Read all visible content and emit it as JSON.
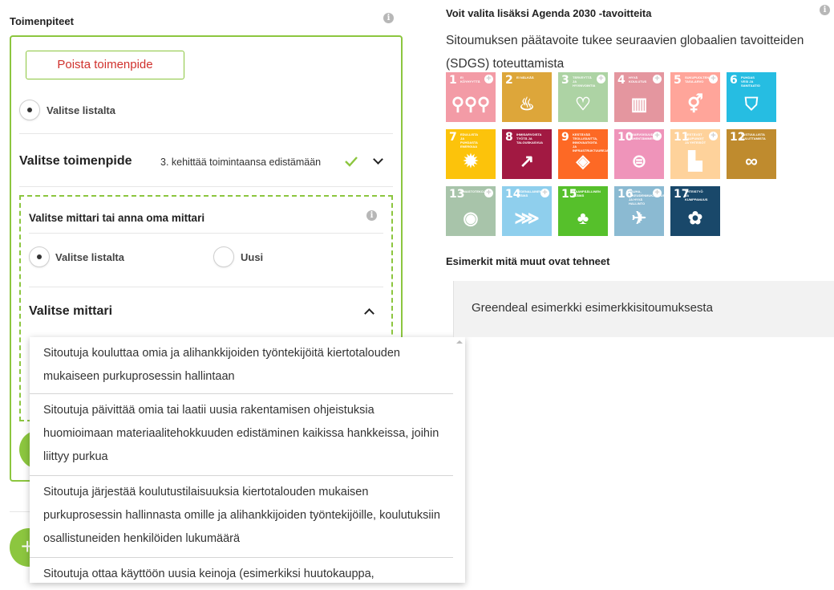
{
  "left": {
    "section_title": "Toimenpiteet",
    "remove_button": "Poista toimenpide",
    "choose_from_list": "Valitse listalta",
    "select_action_label": "Valitse toimenpide",
    "selected_action_value": "3. kehittää toimintaansa edistämään",
    "metric_box": {
      "title": "Valitse mittari tai anna oma mittari",
      "option_list": "Valitse listalta",
      "option_new": "Uusi",
      "select_metric_label": "Valitse mittari"
    }
  },
  "dropdown": {
    "items": [
      "Sitoutuja kouluttaa omia ja alihankkijoiden työntekijöitä kiertotalouden mukaiseen purkuprosessin hallintaan",
      "Sitoutuja päivittää omia tai laatii uusia rakentamisen ohjeistuksia huomioimaan materiaalitehokkuuden edistäminen kaikissa hankkeissa, joihin liittyy purkua",
      "Sitoutuja järjestää koulutustilaisuuksia kiertotalouden mukaisen purkuprosessin hallinnasta omille ja alihankkijoiden työntekijöille, koulutuksiin osallistuneiden henkilöiden lukumäärä",
      "Sitoutuja ottaa käyttöön uusia keinoja (esimerkiksi huutokauppa,"
    ]
  },
  "right": {
    "agenda_title": "Voit valita lisäksi Agenda 2030 -tavoitteita",
    "agenda_desc": "Sitoumuksen päätavoite tukee seuraavien globaalien tavoitteiden (SDGS) toteuttamista",
    "examples_title": "Esimerkit mitä muut ovat tehneet",
    "example_item": "Greendeal esimerkki esimerkkisitoumuksesta"
  },
  "sdg_goals": [
    {
      "num": "1",
      "label": "Ei köyhyyttä",
      "color": "#e5243b",
      "icon": "family-icon",
      "glyph": "⚲⚲⚲",
      "selected": false
    },
    {
      "num": "2",
      "label": "Ei nälkää",
      "color": "#dda63a",
      "icon": "bowl-icon",
      "glyph": "♨",
      "selected": true
    },
    {
      "num": "3",
      "label": "Terveyttä ja hyvinvointia",
      "color": "#4c9f38",
      "icon": "heartbeat-icon",
      "glyph": "♡",
      "selected": false
    },
    {
      "num": "4",
      "label": "Hyvä koulutus",
      "color": "#c5192d",
      "icon": "book-icon",
      "glyph": "▥",
      "selected": false
    },
    {
      "num": "5",
      "label": "Sukupuolten tasa-arvo",
      "color": "#ff3a21",
      "icon": "gender-icon",
      "glyph": "⚥",
      "selected": false
    },
    {
      "num": "6",
      "label": "Puhdas vesi ja sanitaatio",
      "color": "#26bde2",
      "icon": "water-icon",
      "glyph": "⛉",
      "selected": true
    },
    {
      "num": "7",
      "label": "Edullista ja puhdasta energiaa",
      "color": "#fcc30b",
      "icon": "sun-icon",
      "glyph": "✹",
      "selected": true
    },
    {
      "num": "8",
      "label": "Ihmisarvoista työtä ja talouskasvua",
      "color": "#a21942",
      "icon": "growth-icon",
      "glyph": "↗",
      "selected": true
    },
    {
      "num": "9",
      "label": "Kestävää teollisuutta, innovaatioita ja infrastruktuureja",
      "color": "#fd6925",
      "icon": "blocks-icon",
      "glyph": "◈",
      "selected": true
    },
    {
      "num": "10",
      "label": "Eriarvoisuuden vähentäminen",
      "color": "#dd1367",
      "icon": "equal-icon",
      "glyph": "⊜",
      "selected": false
    },
    {
      "num": "11",
      "label": "Kestävät kaupungit ja yhteisöt",
      "color": "#fd9d24",
      "icon": "city-icon",
      "glyph": "▙",
      "selected": false
    },
    {
      "num": "12",
      "label": "Vastuullista kuluttamista",
      "color": "#bf8b2e",
      "icon": "infinity-icon",
      "glyph": "∞",
      "selected": true
    },
    {
      "num": "13",
      "label": "Ilmastotekoja",
      "color": "#3f7e44",
      "icon": "eye-globe-icon",
      "glyph": "◉",
      "selected": false
    },
    {
      "num": "14",
      "label": "Vedenalainen elämä",
      "color": "#0a97d9",
      "icon": "fish-icon",
      "glyph": "⋙",
      "selected": false
    },
    {
      "num": "15",
      "label": "Maanpäällinen elämä",
      "color": "#56c02b",
      "icon": "tree-icon",
      "glyph": "♣",
      "selected": true
    },
    {
      "num": "16",
      "label": "Rauha, oikeudenmukaisuus ja hyvä hallinto",
      "color": "#00689d",
      "icon": "dove-icon",
      "glyph": "✈",
      "selected": false
    },
    {
      "num": "17",
      "label": "Yhteistyö ja kumppanuus",
      "color": "#19486a",
      "icon": "flower-icon",
      "glyph": "✿",
      "selected": true
    }
  ],
  "colors": {
    "green_border": "#8cc63f",
    "check_green": "#8cc63f",
    "remove_red": "#d0312d"
  }
}
